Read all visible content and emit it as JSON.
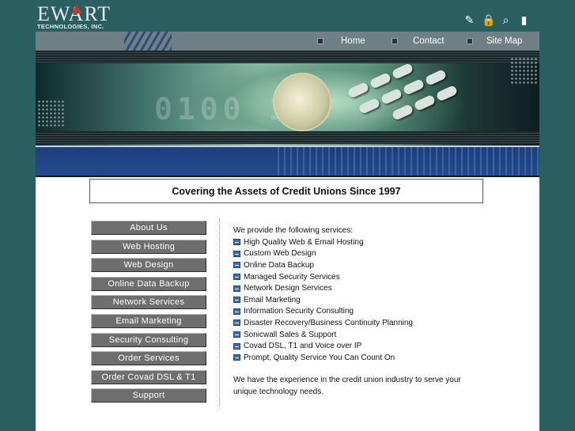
{
  "logo": {
    "name": "EWART",
    "tagline": "TECHNOLOGIES, INC."
  },
  "toolbar_icons": [
    "edit-icon",
    "lock-icon",
    "search-icon",
    "print-icon"
  ],
  "nav": {
    "items": [
      "Home",
      "Contact",
      "Site Map"
    ]
  },
  "banner": {
    "binary": "0100 110"
  },
  "headline": "Covering the Assets of Credit Unions Since 1997",
  "menu": [
    "About Us",
    "Web Hosting",
    "Web Design",
    "Online Data Backup",
    "Network Services",
    "Email Marketing",
    "Security Consulting",
    "Order Services",
    "Order Covad DSL & T1",
    "Support"
  ],
  "services": {
    "intro": "We provide the following services:",
    "items": [
      "High Quality Web & Email Hosting",
      "Custom Web Design",
      "Online Data Backup",
      "Managed Security Services",
      "Network Design Services",
      "Email Marketing",
      "Information Security Consulting",
      "Disaster Recovery/Business Continuity Planning",
      "Sonicwall Sales & Support",
      "Covad DSL, T1 and Voice over IP",
      "Prompt, Quality Service You Can Count On"
    ],
    "closing": "We have the experience in the credit union industry to serve your unique technology needs."
  },
  "colors": {
    "background": "#2a5f62",
    "navbar": "#6f7f86",
    "menu_button": "#6e6e6e",
    "banner_blue": "#1d3f7e",
    "service_icon": "#3d6fb8"
  }
}
